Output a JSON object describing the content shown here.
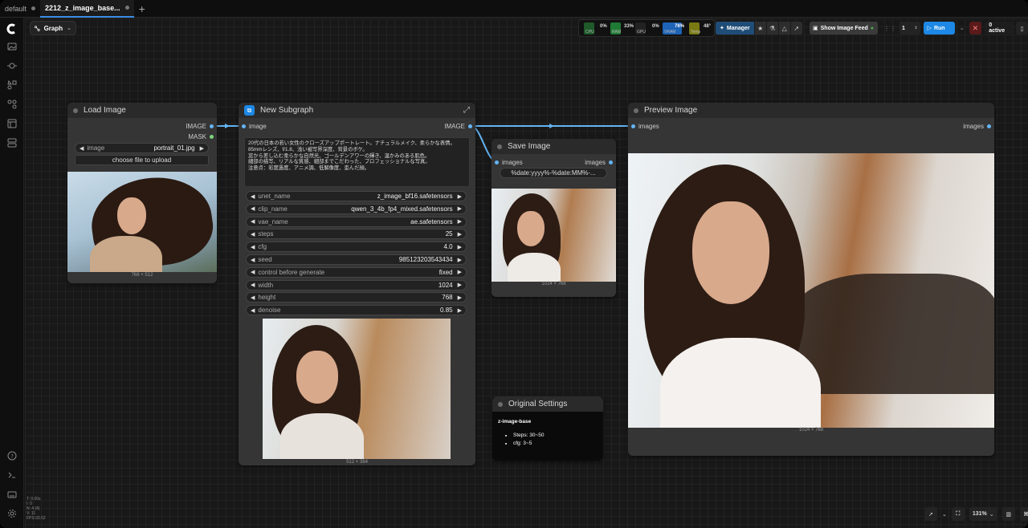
{
  "tabs": [
    {
      "label": "default",
      "active": false
    },
    {
      "label": "2212_z_image_base...",
      "active": true
    }
  ],
  "toolbar": {
    "graph_label": "Graph",
    "stats": {
      "cpu_label": "CPU",
      "cpu_value": "0%",
      "ram_label": "RAM",
      "ram_value": "33%",
      "gpu_label": "GPU",
      "gpu_value": "0%",
      "vram_label": "VRAM",
      "vram_value": "76%",
      "temp_label": "Temp",
      "temp_value": "48°"
    },
    "manager_label": "Manager",
    "feed_label": "Show Image Feed",
    "queue_count": "1",
    "run_label": "Run",
    "active_label": "0 active"
  },
  "nodes": {
    "load_image": {
      "title": "Load Image",
      "out_image": "IMAGE",
      "out_mask": "MASK",
      "image_widget_name": "image",
      "image_widget_value": "portrait_01.jpg",
      "upload_label": "choose file to upload",
      "dims": "768 × 512"
    },
    "subgraph": {
      "title": "New Subgraph",
      "in_image": "image",
      "out_image": "IMAGE",
      "prompt": "20代の日本の若い女性のクローズアップポートレート。ナチュラルメイク、柔らかな表情。\n85mmレンズ、f/1.8、浅い被写界深度、背景のボケ。\n窓から差し込む柔らかな自然光、ゴールデンアワーの輝き、温かみのある肌色。\n細部の描写、リアルな質感、細部までこだわった、プロフェッショナルな写真。\n注意点：彩度過度、アニメ調、低解像度、歪んだ顔。",
      "widgets": [
        {
          "name": "unet_name",
          "value": "z_image_bf16.safetensors"
        },
        {
          "name": "clip_name",
          "value": "qwen_3_4b_fp4_mixed.safetensors"
        },
        {
          "name": "vae_name",
          "value": "ae.safetensors"
        },
        {
          "name": "steps",
          "value": "25"
        },
        {
          "name": "cfg",
          "value": "4.0"
        },
        {
          "name": "seed",
          "value": "985123203543434"
        },
        {
          "name": "control before generate",
          "value": "fixed"
        },
        {
          "name": "width",
          "value": "1024"
        },
        {
          "name": "height",
          "value": "768"
        },
        {
          "name": "denoise",
          "value": "0.85"
        }
      ],
      "dims": "512 × 384"
    },
    "save_image": {
      "title": "Save Image",
      "in_images": "images",
      "out_images": "images",
      "prefix": "%date:yyyy%-%date:MM%-...",
      "dims": "1024 × 768"
    },
    "original_settings": {
      "title": "Original Settings",
      "heading": "z-image-base",
      "items": [
        "Steps: 30~50",
        "cfg: 3~5"
      ]
    },
    "preview_image": {
      "title": "Preview Image",
      "in_images": "images",
      "out_images": "images",
      "dims": "1024 × 768"
    }
  },
  "canvas_info": [
    "T: 0.00s",
    "I: 0",
    "N: 4 [4]",
    "V: 11",
    "FPS:33.52"
  ],
  "zoom": {
    "value": "131%"
  },
  "colors": {
    "accent": "#1d88e5",
    "wire": "#64b5f6",
    "node_bg": "#353535"
  }
}
